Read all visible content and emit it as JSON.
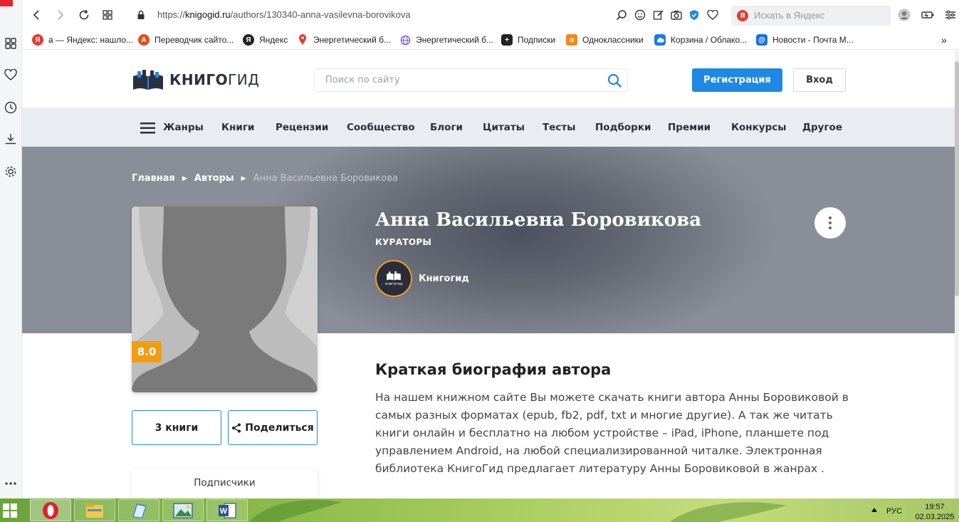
{
  "browser": {
    "url_prefix": "https://",
    "url_host": "knigogid.ru",
    "url_path": "/authors/130340-anna-vasilevna-borovikova",
    "search_placeholder": "Искать в Яндекс",
    "bookmarks": [
      {
        "label": "а — Яндекс: нашло...",
        "icon": "yandex-icon",
        "color": "#e8392f",
        "glyph": "Я"
      },
      {
        "label": "Переводчик сайто...",
        "icon": "translator-icon",
        "color": "#e74c1c",
        "glyph": "A"
      },
      {
        "label": "Яндекс",
        "icon": "yandex-browser-icon",
        "color": "#222222",
        "glyph": "Я"
      },
      {
        "label": "Энергетический б...",
        "icon": "map-pin-icon",
        "color": "#e8392f",
        "glyph": ""
      },
      {
        "label": "Энергетический б...",
        "icon": "globe-icon",
        "color": "#7b5cd6",
        "glyph": ""
      },
      {
        "label": "Подписки",
        "icon": "plus-icon",
        "color": "#222222",
        "glyph": "+"
      },
      {
        "label": "Одноклассники",
        "icon": "odnoklassniki-icon",
        "color": "#f28a1a",
        "glyph": "o"
      },
      {
        "label": "Корзина / Облако...",
        "icon": "cloud-icon",
        "color": "#1a7ce8",
        "glyph": ""
      },
      {
        "label": "Новости - Почта М...",
        "icon": "mail-icon",
        "color": "#1a6fe8",
        "glyph": "@"
      }
    ],
    "more_bookmarks": "»"
  },
  "site": {
    "logo_bold": "КНИГО",
    "logo_light": "ГИД",
    "search_placeholder": "Поиск по сайту",
    "register_label": "Регистрация",
    "login_label": "Вход",
    "nav": [
      "Жанры",
      "Книги",
      "Рецензии",
      "Сообщество",
      "Блоги",
      "Цитаты",
      "Тесты",
      "Подборки",
      "Премии",
      "Конкурсы",
      "Другое"
    ]
  },
  "breadcrumb": {
    "home": "Главная",
    "authors": "Авторы",
    "current": "Анна Васильевна Боровикова"
  },
  "author": {
    "name": "Анна Васильевна Боровикова",
    "curators_label": "КУРАТОРЫ",
    "curator_name": "Книгогид",
    "curator_logo_text": "книгогид",
    "rating": "8.0",
    "books_label": "3 книги",
    "share_label": "Поделиться",
    "subscribers_label": "Подписчики"
  },
  "bio": {
    "title": "Краткая биография автора",
    "text": "На нашем книжном сайте Вы можете скачать книги автора Анны Боровиковой в самых разных форматах (epub, fb2, pdf, txt и многие другие). А так же читать книги онлайн и бесплатно на любом устройстве – iPad, iPhone, планшете под управлением Android, на любой специализированной читалке. Электронная библиотека КнигоГид предлагает литературу Анны Боровиковой в жанрах ."
  },
  "taskbar": {
    "language": "РУС",
    "time": "19:57",
    "date": "02.03.2025",
    "apps": [
      "opera-icon",
      "file-explorer-icon",
      "notebook-icon",
      "image-viewer-icon",
      "word-icon"
    ]
  },
  "colors": {
    "accent": "#1e88e5",
    "rating": "#f39c12",
    "hero": "#646873",
    "nav_bg": "#e9ecf0"
  }
}
